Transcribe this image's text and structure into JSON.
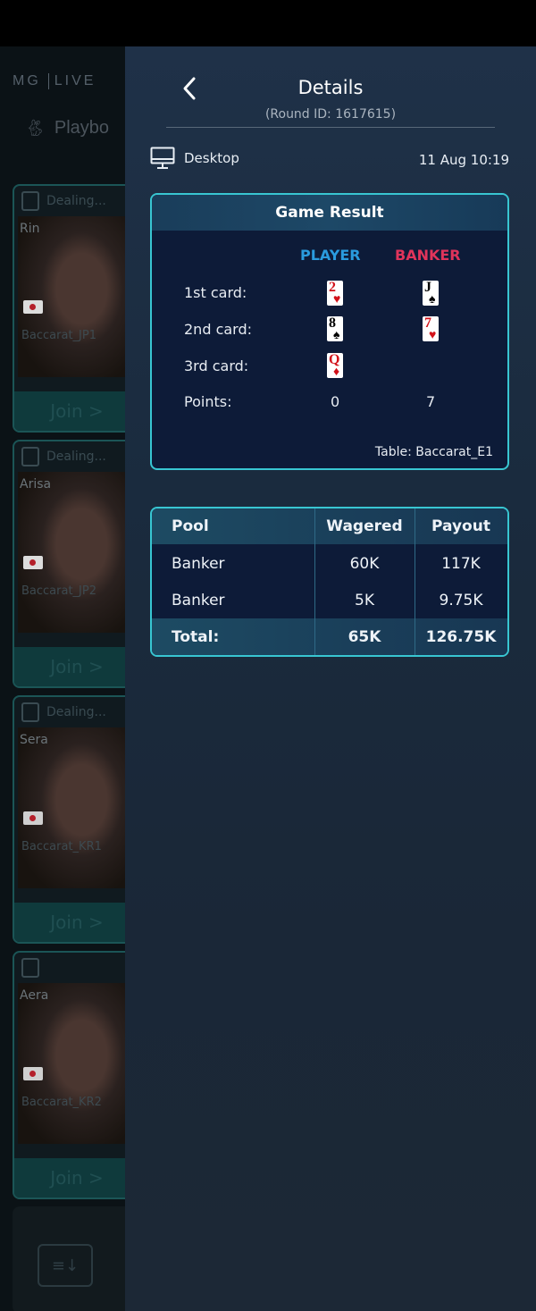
{
  "lobby": {
    "logo": {
      "left": "MG",
      "right": "LIVE"
    },
    "brand": "Playbo",
    "dealers": [
      {
        "status": "Dealing...",
        "name": "Rin",
        "table": "Baccarat_JP1",
        "join": "Join >"
      },
      {
        "status": "Dealing...",
        "name": "Arisa",
        "table": "Baccarat_JP2",
        "join": "Join >"
      },
      {
        "status": "Dealing...",
        "name": "Sera",
        "table": "Baccarat_KR1",
        "join": "Join >"
      },
      {
        "status": "",
        "name": "Aera",
        "table": "Baccarat_KR2",
        "join": "Join >"
      }
    ]
  },
  "details": {
    "title": "Details",
    "round_id": "(Round ID: 1617615)",
    "device": "Desktop",
    "datetime": "11 Aug 10:19"
  },
  "game_result": {
    "title": "Game Result",
    "player_label": "PLAYER",
    "banker_label": "BANKER",
    "rows": [
      "1st card:",
      "2nd card:",
      "3rd card:",
      "Points:"
    ],
    "player_cards": [
      {
        "rank": "2",
        "suit": "♥"
      },
      {
        "rank": "8",
        "suit": "♠"
      },
      {
        "rank": "Q",
        "suit": "♦"
      }
    ],
    "banker_cards": [
      {
        "rank": "J",
        "suit": "♠"
      },
      {
        "rank": "7",
        "suit": "♥"
      }
    ],
    "player_points": "0",
    "banker_points": "7",
    "table": "Table: Baccarat_E1"
  },
  "pool_table": {
    "headers": [
      "Pool",
      "Wagered",
      "Payout"
    ],
    "rows": [
      [
        "Banker",
        "60K",
        "117K"
      ],
      [
        "Banker",
        "5K",
        "9.75K"
      ]
    ],
    "total": [
      "Total:",
      "65K",
      "126.75K"
    ]
  }
}
